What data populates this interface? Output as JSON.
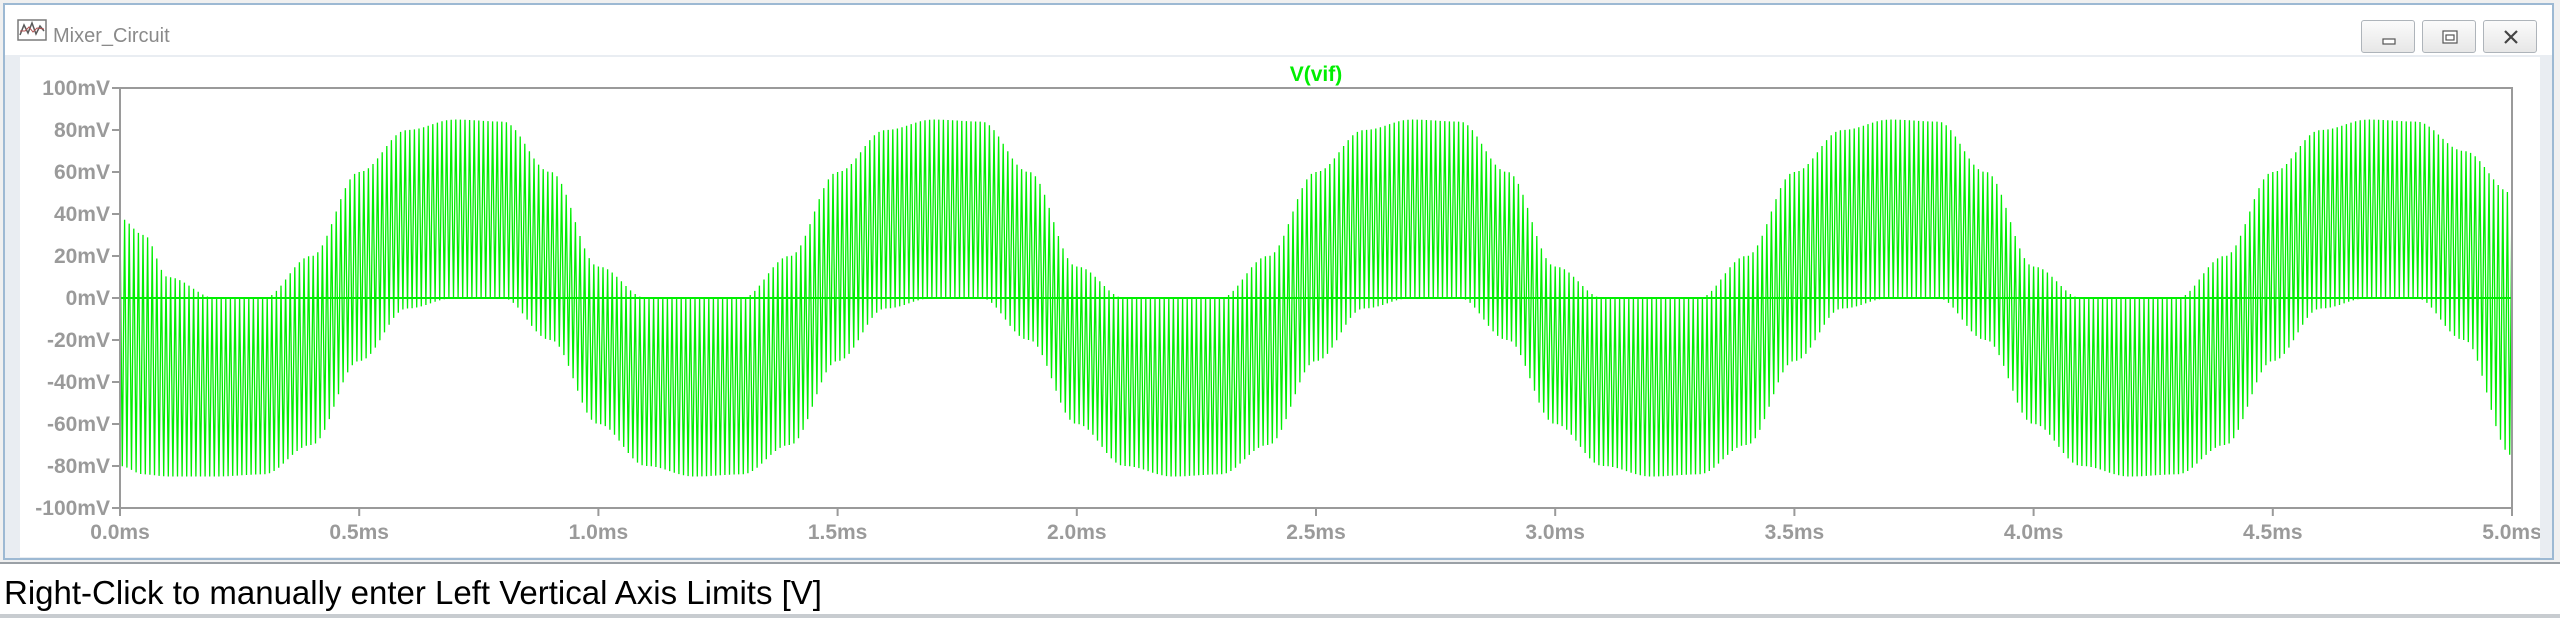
{
  "window": {
    "title": "Mixer_Circuit",
    "buttons": {
      "minimize": "minimize-icon",
      "maximize": "maximize-icon",
      "close": "close-icon"
    }
  },
  "colors": {
    "trace": "#00ee00",
    "axis_text": "#9a9a9a",
    "frame": "#9a9a9a",
    "background": "#ffffff"
  },
  "status": {
    "text": "Right-Click to manually enter Left Vertical Axis Limits [V]"
  },
  "chart_data": {
    "type": "line",
    "title": "V(vif)",
    "xlabel": "",
    "ylabel": "",
    "xlim": [
      0.0,
      5.0
    ],
    "ylim": [
      -100,
      100
    ],
    "x_unit": "ms",
    "y_unit": "mV",
    "x_ticks": [
      "0.0ms",
      "0.5ms",
      "1.0ms",
      "1.5ms",
      "2.0ms",
      "2.5ms",
      "3.0ms",
      "3.5ms",
      "4.0ms",
      "4.5ms",
      "5.0ms"
    ],
    "y_ticks": [
      "100mV",
      "80mV",
      "60mV",
      "40mV",
      "20mV",
      "0mV",
      "-20mV",
      "-40mV",
      "-60mV",
      "-80mV",
      "-100mV"
    ],
    "grid": false,
    "series": [
      {
        "name": "V(vif)",
        "description_envelope": "Carrier with envelope alternating between positive-side (0 to +85mV) and negative-side (0 to -85mV) with period 1.0ms",
        "envelope_x_ms": [
          0.0,
          0.05,
          0.1,
          0.2,
          0.3,
          0.4,
          0.5,
          0.6,
          0.7,
          0.8,
          0.9,
          1.0,
          1.1,
          1.2,
          1.3,
          1.4,
          1.5,
          1.6,
          1.7,
          1.8,
          1.9,
          2.0,
          2.1,
          2.2,
          2.3,
          2.4,
          2.5,
          2.6,
          2.7,
          2.8,
          2.9,
          3.0,
          3.1,
          3.2,
          3.3,
          3.4,
          3.5,
          3.6,
          3.7,
          3.8,
          3.9,
          4.0,
          4.1,
          4.2,
          4.3,
          4.4,
          4.5,
          4.6,
          4.7,
          4.8,
          4.9,
          5.0
        ],
        "upper_mV": [
          38,
          30,
          10,
          0,
          0,
          20,
          60,
          80,
          85,
          84,
          60,
          15,
          0,
          0,
          0,
          20,
          60,
          80,
          85,
          84,
          60,
          15,
          0,
          0,
          0,
          20,
          60,
          80,
          85,
          84,
          60,
          15,
          0,
          0,
          0,
          20,
          60,
          80,
          85,
          84,
          60,
          15,
          0,
          0,
          0,
          20,
          60,
          80,
          85,
          84,
          70,
          50
        ],
        "lower_mV": [
          -80,
          -84,
          -85,
          -85,
          -84,
          -70,
          -30,
          -5,
          0,
          0,
          -20,
          -60,
          -80,
          -85,
          -84,
          -70,
          -30,
          -5,
          0,
          0,
          -20,
          -60,
          -80,
          -85,
          -84,
          -70,
          -30,
          -5,
          0,
          0,
          -20,
          -60,
          -80,
          -85,
          -84,
          -70,
          -30,
          -5,
          0,
          0,
          -20,
          -60,
          -80,
          -85,
          -84,
          -70,
          -30,
          -5,
          0,
          0,
          -20,
          -75
        ]
      }
    ]
  }
}
